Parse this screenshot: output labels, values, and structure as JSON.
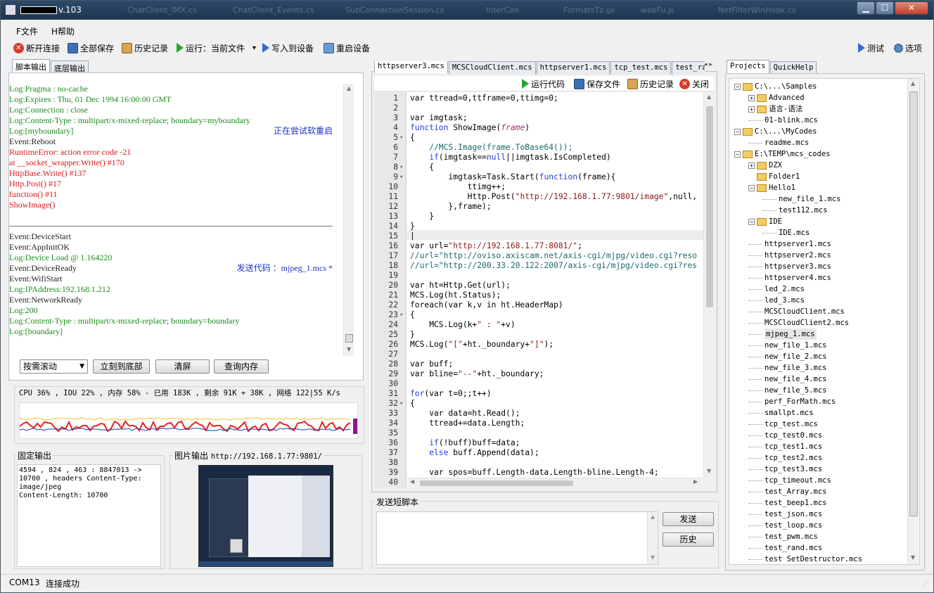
{
  "window": {
    "title_suffix": "v.103",
    "ghost_tabs": [
      "ChatClient_IMX.cs",
      "ChatClient_Events.cs",
      "SubConnectionSession.cs",
      "InterCon",
      "FormatsTz.gs",
      "webFu.js",
      "NetFilterWinHook.cs"
    ],
    "min": "▁",
    "max": "☐",
    "close": "✕"
  },
  "menu": [
    "F文件",
    "H帮助"
  ],
  "toolbar": {
    "disconnect": "断开连接",
    "save_all": "全部保存",
    "history": "历史记录",
    "run": "运行：当前文件",
    "run_arrow": "▾",
    "write": "写入到设备",
    "restart": "重启设备",
    "test": "测试",
    "options": "选项"
  },
  "left": {
    "tabs": [
      "脚本输出",
      "底层输出"
    ],
    "log": [
      {
        "t": "Log:Pragma : no-cache",
        "c": "g"
      },
      {
        "t": "Log:Expires : Thu, 01 Dec 1994 16:00:00 GMT",
        "c": "g"
      },
      {
        "t": "Log:Connection : close",
        "c": "g"
      },
      {
        "t": "Log:Content-Type : multipart/x-mixed-replace; boundary=myboundary",
        "c": "g"
      },
      {
        "t": "Log:[myboundary]",
        "c": "g"
      },
      {
        "t": "正在尝试软重启",
        "c": "b",
        "right": true
      },
      {
        "t": "Event:Reboot",
        "c": "k"
      },
      {
        "t": "RuntimeError:  action error code -21",
        "c": "r"
      },
      {
        "t": " at __socket_wrapper.Write() #170",
        "c": "r"
      },
      {
        "t": "  HttpBase.Write() #137",
        "c": "r"
      },
      {
        "t": "  Http.Post() #17",
        "c": "r"
      },
      {
        "t": "  function() #11",
        "c": "r"
      },
      {
        "t": "  ShowImage()",
        "c": "r"
      },
      {
        "t": "",
        "c": "k"
      },
      {
        "t": "",
        "c": "hr"
      },
      {
        "t": "Event:DeviceStart",
        "c": "k"
      },
      {
        "t": "Event:AppInitOK",
        "c": "k"
      },
      {
        "t": "Log:Device Load @ 1.164220",
        "c": "g"
      },
      {
        "t": "Event:DeviceReady",
        "c": "k"
      },
      {
        "t": "发送代码 ：mjpeg_1.mcs *",
        "c": "b",
        "right": true
      },
      {
        "t": "Event:WifiStart",
        "c": "k"
      },
      {
        "t": "Log:IPAddress:192.168.1.212",
        "c": "g"
      },
      {
        "t": "Event:NetworkReady",
        "c": "k"
      },
      {
        "t": "Log:200",
        "c": "g"
      },
      {
        "t": "Log:Content-Type : multipart/x-mixed-replace; boundary=boundary",
        "c": "g"
      },
      {
        "t": "Log:[boundary]",
        "c": "g"
      }
    ],
    "scroll_select": "按需滚动",
    "buttons": [
      "立刻到底部",
      "清屏",
      "查询内存"
    ],
    "stats": "CPU 36% , IOU 22% , 内存 58% - 已用 183K , 剩余 91K + 38K , 网络 122|55 K/s",
    "fixed_title": "固定输出",
    "fixed_text": [
      "4594 , 824 , 463 : 8847013 ->",
      "10700 , headers Content-Type:",
      "image/jpeg",
      "Content-Length: 10700"
    ],
    "image_title": "图片输出",
    "image_url": "http://192.168.1.77:9801/"
  },
  "editor": {
    "tabs": [
      "httpserver3.mcs",
      "MCSCloudClient.mcs",
      "httpserver1.mcs",
      "tcp_test.mcs",
      "test_ra"
    ],
    "actions": {
      "run": "运行代码",
      "save": "保存文件",
      "history": "历史记录",
      "close": "关闭"
    },
    "lines": [
      {
        "n": "1",
        "f": "",
        "h": [
          [
            "",
            "var ttread=0,ttframe=0,ttimg=0;"
          ]
        ]
      },
      {
        "n": "2",
        "f": "",
        "h": []
      },
      {
        "n": "3",
        "f": "",
        "h": [
          [
            "",
            "var imgtask;"
          ]
        ]
      },
      {
        "n": "4",
        "f": "",
        "h": [
          [
            "kw",
            "function"
          ],
          [
            "",
            " ShowImage("
          ],
          [
            "pm",
            "frame"
          ],
          [
            "",
            ")"
          ]
        ]
      },
      {
        "n": "5",
        "f": "▾",
        "h": [
          [
            "",
            "{"
          ]
        ]
      },
      {
        "n": "6",
        "f": "",
        "h": [
          [
            "cm",
            "    //MCS.Image(frame.ToBase64());"
          ]
        ]
      },
      {
        "n": "7",
        "f": "",
        "h": [
          [
            "kw",
            "    if"
          ],
          [
            "",
            "(imgtask=="
          ],
          [
            "kw",
            "null"
          ],
          [
            "",
            "||imgtask.IsCompleted)"
          ]
        ]
      },
      {
        "n": "8",
        "f": "▾",
        "h": [
          [
            "",
            "    {"
          ]
        ]
      },
      {
        "n": "9",
        "f": "▾",
        "h": [
          [
            "",
            "        imgtask=Task.Start("
          ],
          [
            "kw",
            "function"
          ],
          [
            "",
            "(frame){"
          ]
        ]
      },
      {
        "n": "10",
        "f": "",
        "h": [
          [
            "",
            "            ttimg++;"
          ]
        ]
      },
      {
        "n": "11",
        "f": "",
        "h": [
          [
            "",
            "            Http.Post("
          ],
          [
            "str",
            "\"http://192.168.1.77:9801/image\""
          ],
          [
            "",
            ",null,"
          ]
        ]
      },
      {
        "n": "12",
        "f": "",
        "h": [
          [
            "",
            "        },frame);"
          ]
        ]
      },
      {
        "n": "13",
        "f": "",
        "h": [
          [
            "",
            "    }"
          ]
        ]
      },
      {
        "n": "14",
        "f": "",
        "h": [
          [
            "",
            "}"
          ]
        ]
      },
      {
        "n": "15",
        "f": "",
        "h": [
          [
            "",
            "|"
          ]
        ]
      },
      {
        "n": "16",
        "f": "",
        "h": [
          [
            "",
            "var url="
          ],
          [
            "str",
            "\"http://192.168.1.77:8081/\""
          ],
          [
            "",
            ";"
          ]
        ]
      },
      {
        "n": "17",
        "f": "",
        "h": [
          [
            "cm",
            "//url=\"http://oviso.axiscam.net/axis-cgi/mjpg/video.cgi?reso"
          ]
        ]
      },
      {
        "n": "18",
        "f": "",
        "h": [
          [
            "cm",
            "//url=\"http://200.33.20.122:2007/axis-cgi/mjpg/video.cgi?res"
          ]
        ]
      },
      {
        "n": "19",
        "f": "",
        "h": []
      },
      {
        "n": "20",
        "f": "",
        "h": [
          [
            "",
            "var ht=Http.Get(url);"
          ]
        ]
      },
      {
        "n": "21",
        "f": "",
        "h": [
          [
            "",
            "MCS.Log(ht.Status);"
          ]
        ]
      },
      {
        "n": "22",
        "f": "",
        "h": [
          [
            "",
            "foreach(var k,v in ht.HeaderMap)"
          ]
        ]
      },
      {
        "n": "23",
        "f": "▾",
        "h": [
          [
            "",
            "{"
          ]
        ]
      },
      {
        "n": "24",
        "f": "",
        "h": [
          [
            "",
            "    MCS.Log(k+"
          ],
          [
            "str",
            "\" : \""
          ],
          [
            "",
            "+v)"
          ]
        ]
      },
      {
        "n": "25",
        "f": "",
        "h": [
          [
            "",
            "}"
          ]
        ]
      },
      {
        "n": "26",
        "f": "",
        "h": [
          [
            "",
            "MCS.Log("
          ],
          [
            "str",
            "\"[\""
          ],
          [
            "",
            "+ht._boundary+"
          ],
          [
            "str",
            "\"]\""
          ],
          [
            "",
            ");"
          ]
        ]
      },
      {
        "n": "27",
        "f": "",
        "h": []
      },
      {
        "n": "28",
        "f": "",
        "h": [
          [
            "",
            "var buff;"
          ]
        ]
      },
      {
        "n": "29",
        "f": "",
        "h": [
          [
            "",
            "var bline="
          ],
          [
            "str",
            "\"--\""
          ],
          [
            "",
            "+ht._boundary;"
          ]
        ]
      },
      {
        "n": "30",
        "f": "",
        "h": []
      },
      {
        "n": "31",
        "f": "",
        "h": [
          [
            "kw",
            "for"
          ],
          [
            "",
            "(var t=0;;t++)"
          ]
        ]
      },
      {
        "n": "32",
        "f": "▾",
        "h": [
          [
            "",
            "{"
          ]
        ]
      },
      {
        "n": "33",
        "f": "",
        "h": [
          [
            "",
            "    var data=ht.Read();"
          ]
        ]
      },
      {
        "n": "34",
        "f": "",
        "h": [
          [
            "",
            "    ttread+=data.Length;"
          ]
        ]
      },
      {
        "n": "35",
        "f": "",
        "h": []
      },
      {
        "n": "36",
        "f": "",
        "h": [
          [
            "kw",
            "    if"
          ],
          [
            "",
            "(!buff)buff=data;"
          ]
        ]
      },
      {
        "n": "37",
        "f": "",
        "h": [
          [
            "kw",
            "    else"
          ],
          [
            "",
            " buff.Append(data);"
          ]
        ]
      },
      {
        "n": "38",
        "f": "",
        "h": []
      },
      {
        "n": "39",
        "f": "",
        "h": [
          [
            "",
            "    var spos=buff.Length-data.Length-bline.Length-4;"
          ]
        ]
      },
      {
        "n": "40",
        "f": "",
        "h": [
          [
            "",
            "    "
          ]
        ]
      }
    ],
    "send_title": "发送短脚本",
    "send_btn": "发送",
    "history_btn": "历史"
  },
  "projects": {
    "tabs": [
      "Projects",
      "QuickHelp"
    ],
    "items": [
      {
        "d": 0,
        "type": "root",
        "exp": "−",
        "label": "C:\\...\\Samples"
      },
      {
        "d": 1,
        "type": "folder",
        "exp": "+",
        "label": "Advanced"
      },
      {
        "d": 1,
        "type": "folder",
        "exp": "+",
        "label": "语言-语法"
      },
      {
        "d": 1,
        "type": "file",
        "label": "01-blink.mcs"
      },
      {
        "d": 0,
        "type": "root",
        "exp": "−",
        "label": "C:\\...\\MyCodes"
      },
      {
        "d": 1,
        "type": "file",
        "label": "readme.mcs"
      },
      {
        "d": 0,
        "type": "root",
        "exp": "−",
        "label": "E:\\TEMP\\mcs_codes"
      },
      {
        "d": 1,
        "type": "folder",
        "exp": "+",
        "label": "DZX"
      },
      {
        "d": 1,
        "type": "folder",
        "exp": "",
        "label": "Folder1"
      },
      {
        "d": 1,
        "type": "folder",
        "exp": "−",
        "label": "Hello1"
      },
      {
        "d": 2,
        "type": "file",
        "label": "new_file_1.mcs"
      },
      {
        "d": 2,
        "type": "file",
        "label": "test112.mcs"
      },
      {
        "d": 1,
        "type": "folder",
        "exp": "−",
        "label": "IDE"
      },
      {
        "d": 2,
        "type": "file",
        "label": "IDE.mcs"
      },
      {
        "d": 1,
        "type": "file",
        "label": "httpserver1.mcs"
      },
      {
        "d": 1,
        "type": "file",
        "label": "httpserver2.mcs"
      },
      {
        "d": 1,
        "type": "file",
        "label": "httpserver3.mcs"
      },
      {
        "d": 1,
        "type": "file",
        "label": "httpserver4.mcs"
      },
      {
        "d": 1,
        "type": "file",
        "label": "led_2.mcs"
      },
      {
        "d": 1,
        "type": "file",
        "label": "led_3.mcs"
      },
      {
        "d": 1,
        "type": "file",
        "label": "MCSCloudClient.mcs"
      },
      {
        "d": 1,
        "type": "file",
        "label": "MCSCloudClient2.mcs"
      },
      {
        "d": 1,
        "type": "file",
        "label": "mjpeg_1.mcs",
        "sel": true
      },
      {
        "d": 1,
        "type": "file",
        "label": "new_file_1.mcs"
      },
      {
        "d": 1,
        "type": "file",
        "label": "new_file_2.mcs"
      },
      {
        "d": 1,
        "type": "file",
        "label": "new_file_3.mcs"
      },
      {
        "d": 1,
        "type": "file",
        "label": "new_file_4.mcs"
      },
      {
        "d": 1,
        "type": "file",
        "label": "new_file_5.mcs"
      },
      {
        "d": 1,
        "type": "file",
        "label": "perf_ForMath.mcs"
      },
      {
        "d": 1,
        "type": "file",
        "label": "smallpt.mcs"
      },
      {
        "d": 1,
        "type": "file",
        "label": "tcp_test.mcs"
      },
      {
        "d": 1,
        "type": "file",
        "label": "tcp_test0.mcs"
      },
      {
        "d": 1,
        "type": "file",
        "label": "tcp_test1.mcs"
      },
      {
        "d": 1,
        "type": "file",
        "label": "tcp_test2.mcs"
      },
      {
        "d": 1,
        "type": "file",
        "label": "tcp_test3.mcs"
      },
      {
        "d": 1,
        "type": "file",
        "label": "tcp_timeout.mcs"
      },
      {
        "d": 1,
        "type": "file",
        "label": "test_Array.mcs"
      },
      {
        "d": 1,
        "type": "file",
        "label": "test_beep1.mcs"
      },
      {
        "d": 1,
        "type": "file",
        "label": "test_json.mcs"
      },
      {
        "d": 1,
        "type": "file",
        "label": "test_loop.mcs"
      },
      {
        "d": 1,
        "type": "file",
        "label": "test_pwm.mcs"
      },
      {
        "d": 1,
        "type": "file",
        "label": "test_rand.mcs"
      },
      {
        "d": 1,
        "type": "file",
        "label": "test_SetDestructor.mcs"
      }
    ]
  },
  "status": {
    "port": "COM13",
    "text": "连接成功"
  },
  "colors": {
    "log_green": "#1f8a1f",
    "log_red": "#d51a1a",
    "log_blue": "#1a32c8",
    "cpu_line": "#e8221c",
    "mem_line": "#1a3aa8",
    "net_line": "#f0c020"
  }
}
